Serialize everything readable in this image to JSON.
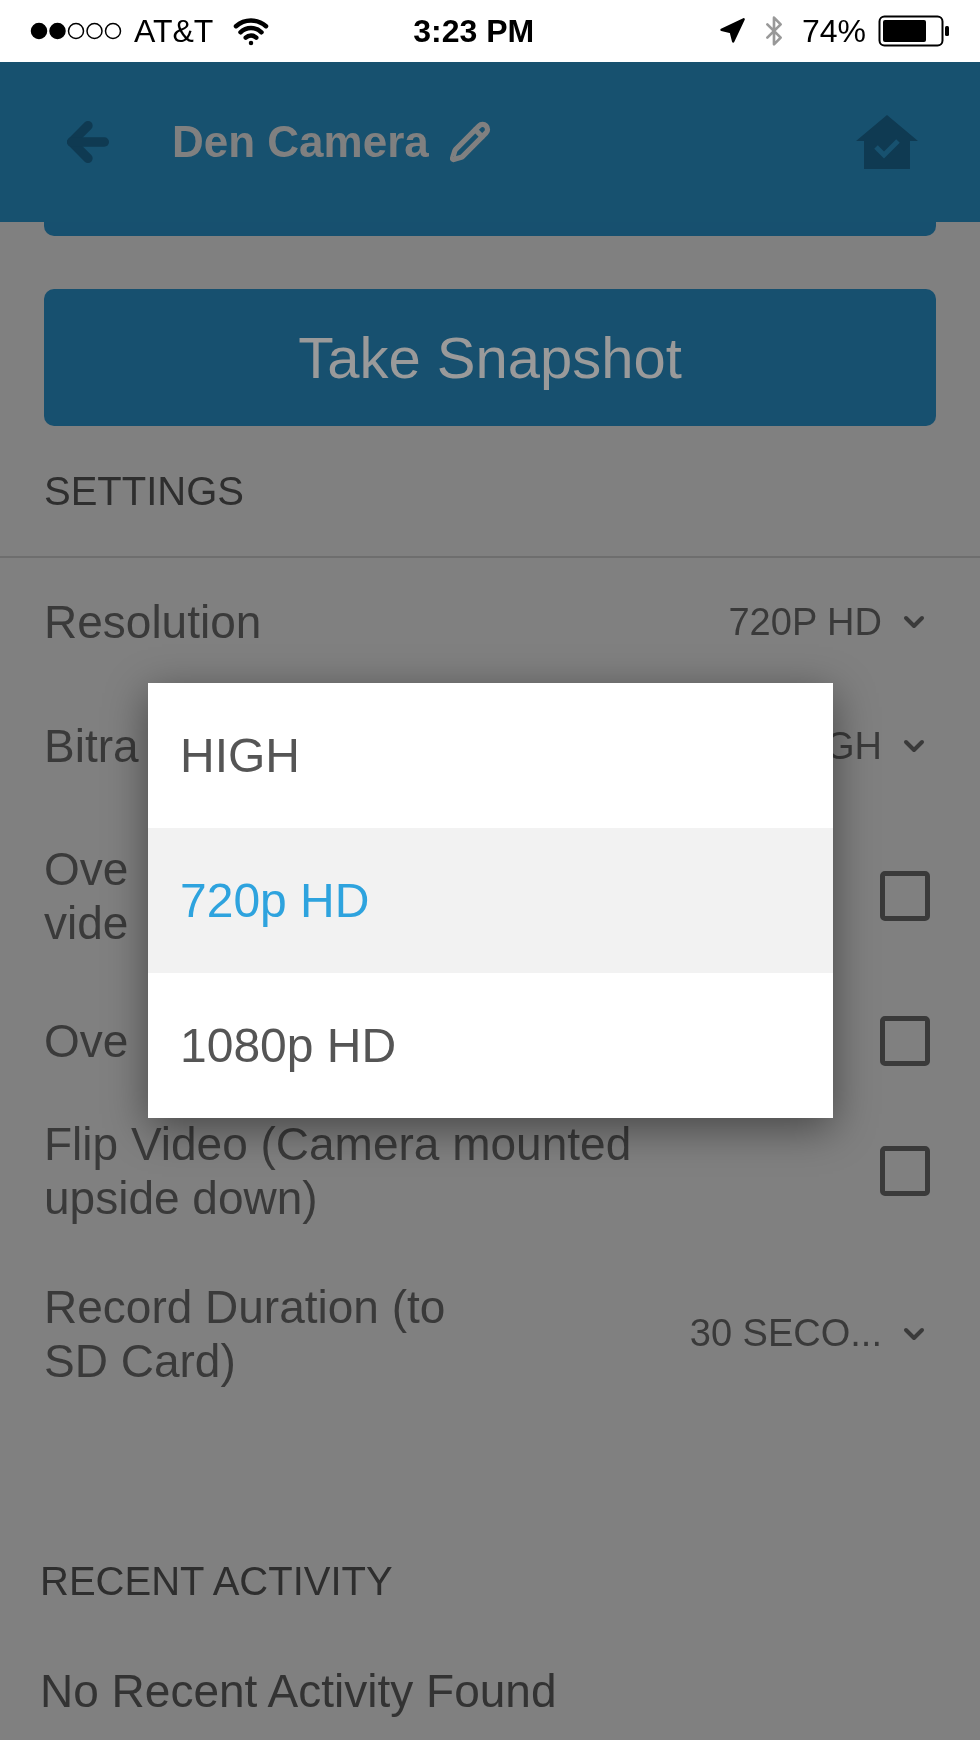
{
  "status_bar": {
    "carrier": "AT&T",
    "time": "3:23 PM",
    "battery": "74%"
  },
  "header": {
    "title": "Den Camera"
  },
  "snapshot_button": "Take Snapshot",
  "settings": {
    "heading": "SETTINGS",
    "rows": [
      {
        "kind": "select",
        "label": [
          "Resolution"
        ],
        "value": "720P HD"
      },
      {
        "kind": "select",
        "label": [
          "Bitra"
        ],
        "value": "GH"
      },
      {
        "kind": "checkbox",
        "label": [
          "Ove",
          "vide"
        ],
        "checked": false
      },
      {
        "kind": "checkbox",
        "label": [
          "Ove"
        ],
        "checked": false
      },
      {
        "kind": "checkbox",
        "label": [
          "Flip Video (Camera mounted",
          "upside down)"
        ],
        "checked": false
      },
      {
        "kind": "select",
        "label": [
          "Record Duration (to",
          "SD Card)"
        ],
        "value": "30 SECO..."
      }
    ]
  },
  "recent_activity": {
    "heading": "RECENT ACTIVITY",
    "empty_message": "No Recent Activity Found"
  },
  "dropdown_menu": {
    "options": [
      {
        "label": "HIGH",
        "selected": false
      },
      {
        "label": "720p HD",
        "selected": true
      },
      {
        "label": "1080p HD",
        "selected": false
      }
    ]
  }
}
